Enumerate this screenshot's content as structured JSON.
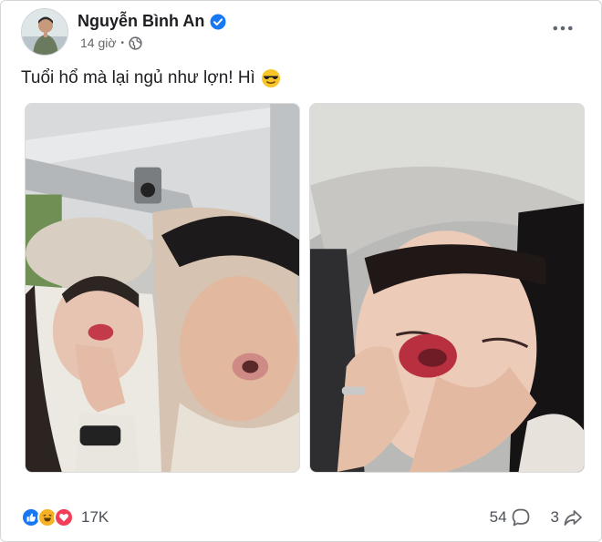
{
  "post": {
    "author": "Nguyễn Bình An",
    "time": "14 giờ",
    "caption": "Tuổi hổ mà lại ngủ như lợn! Hì",
    "caption_emoji": "smiling-face-with-sunglasses-icon",
    "reactions_count": "17K",
    "comments_count": "54",
    "shares_count": "3"
  },
  "icons": {
    "verified": "verified-badge-icon",
    "privacy": "globe-icon",
    "more": "more-options-icon",
    "reactions": [
      "like-icon",
      "haha-icon",
      "love-icon"
    ],
    "comment": "comment-icon",
    "share": "share-icon"
  },
  "colors": {
    "verified_blue": "#1877f2",
    "like_blue": "#1877f2",
    "haha_yellow": "#f7b125",
    "love_red": "#f33e58",
    "meta_gray": "#65676b"
  }
}
